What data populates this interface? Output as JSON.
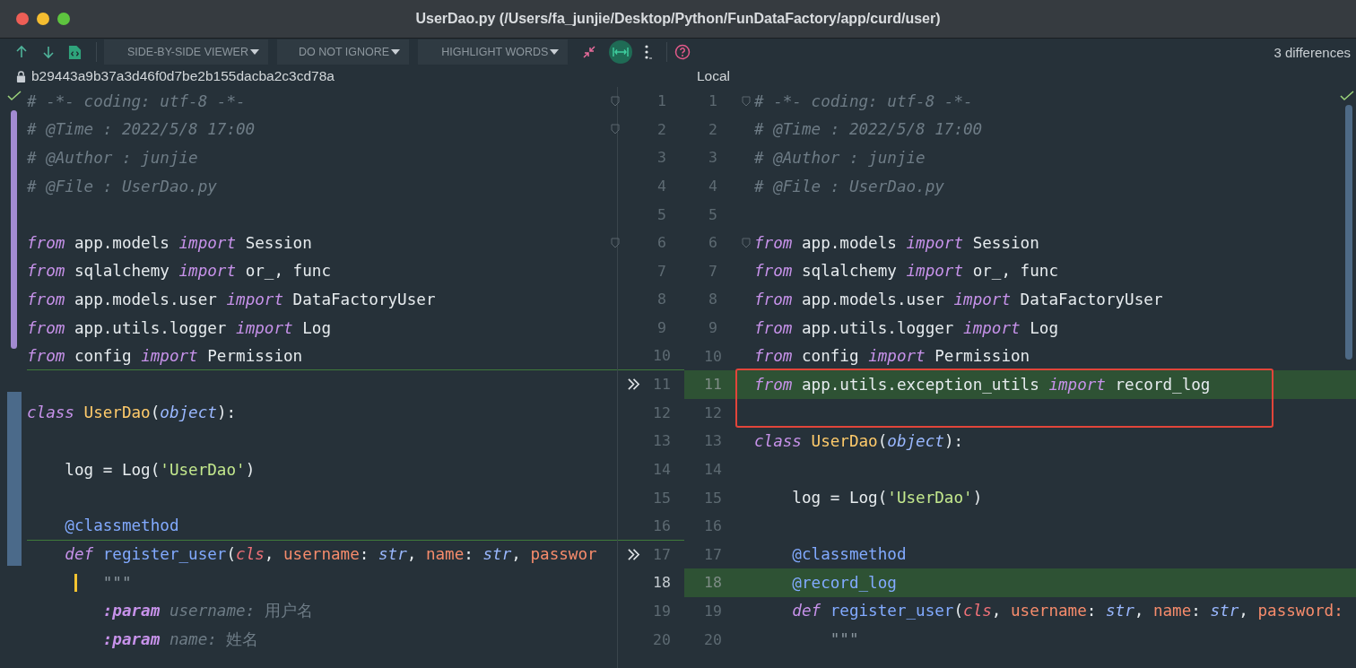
{
  "window": {
    "title": "UserDao.py (/Users/fa_junjie/Desktop/Python/FunDataFactory/app/curd/user)"
  },
  "toolbar": {
    "dropdowns": [
      "SIDE-BY-SIDE VIEWER",
      "DO NOT IGNORE",
      "HIGHLIGHT WORDS"
    ],
    "sync_scroll_on": true,
    "differences": "3 differences"
  },
  "left": {
    "revision": "b29443a9b37a3d46f0d7be2b155dacba2c3cd78a",
    "lines": [
      {
        "no": "1",
        "fold": true,
        "tokens": [
          {
            "kind": "comment",
            "t": "# -*- coding: utf-8 -*-"
          }
        ]
      },
      {
        "no": "2",
        "fold": true,
        "tokens": [
          {
            "kind": "comment",
            "t": "# @Time : 2022/5/8 17:00"
          }
        ]
      },
      {
        "no": "3",
        "tokens": [
          {
            "kind": "comment",
            "t": "# @Author : junjie"
          }
        ]
      },
      {
        "no": "4",
        "tokens": [
          {
            "kind": "comment",
            "t": "# @File : UserDao.py"
          }
        ]
      },
      {
        "no": "5"
      },
      {
        "no": "6",
        "fold": true,
        "tokens": [
          {
            "kind": "keyword",
            "t": "from"
          },
          {
            "kind": "plain",
            "t": " app.models "
          },
          {
            "kind": "keyword",
            "t": "import"
          },
          {
            "kind": "plain",
            "t": " Session"
          }
        ]
      },
      {
        "no": "7",
        "tokens": [
          {
            "kind": "keyword",
            "t": "from"
          },
          {
            "kind": "plain",
            "t": " sqlalchemy "
          },
          {
            "kind": "keyword",
            "t": "import"
          },
          {
            "kind": "plain",
            "t": " or_, func"
          }
        ]
      },
      {
        "no": "8",
        "tokens": [
          {
            "kind": "keyword",
            "t": "from"
          },
          {
            "kind": "plain",
            "t": " app.models.user "
          },
          {
            "kind": "keyword",
            "t": "import"
          },
          {
            "kind": "plain",
            "t": " DataFactoryUser"
          }
        ]
      },
      {
        "no": "9",
        "tokens": [
          {
            "kind": "keyword",
            "t": "from"
          },
          {
            "kind": "plain",
            "t": " app.utils.logger "
          },
          {
            "kind": "keyword",
            "t": "import"
          },
          {
            "kind": "plain",
            "t": " Log"
          }
        ]
      },
      {
        "no": "10",
        "inserted_below": true,
        "tokens": [
          {
            "kind": "keyword",
            "t": "from"
          },
          {
            "kind": "plain",
            "t": " config "
          },
          {
            "kind": "keyword",
            "t": "import"
          },
          {
            "kind": "plain",
            "t": " Permission"
          }
        ]
      },
      {
        "no": "11",
        "merge_arrow": true
      },
      {
        "no": "12",
        "tokens": [
          {
            "kind": "keyword",
            "t": "class"
          },
          {
            "kind": "classname",
            "t": " UserDao"
          },
          {
            "kind": "plain",
            "t": "("
          },
          {
            "kind": "type",
            "t": "object"
          },
          {
            "kind": "plain",
            "t": "):"
          }
        ]
      },
      {
        "no": "13"
      },
      {
        "no": "14",
        "tokens": [
          {
            "kind": "plain",
            "t": "    log = Log("
          },
          {
            "kind": "string",
            "t": "'UserDao'"
          },
          {
            "kind": "plain",
            "t": ")"
          }
        ]
      },
      {
        "no": "15"
      },
      {
        "no": "16",
        "inserted_below": true,
        "tokens": [
          {
            "kind": "decorator",
            "t": "    @classmethod"
          }
        ]
      },
      {
        "no": "17",
        "merge_arrow": true,
        "tokens": [
          {
            "kind": "keyword",
            "t": "    def"
          },
          {
            "kind": "function",
            "t": " register_user"
          },
          {
            "kind": "plain",
            "t": "("
          },
          {
            "kind": "self",
            "t": "cls"
          },
          {
            "kind": "plain",
            "t": ", "
          },
          {
            "kind": "param",
            "t": "username"
          },
          {
            "kind": "plain",
            "t": ": "
          },
          {
            "kind": "type",
            "t": "str"
          },
          {
            "kind": "plain",
            "t": ", "
          },
          {
            "kind": "param",
            "t": "name"
          },
          {
            "kind": "plain",
            "t": ": "
          },
          {
            "kind": "type",
            "t": "str"
          },
          {
            "kind": "plain",
            "t": ", "
          },
          {
            "kind": "param",
            "t": "passwor"
          }
        ]
      },
      {
        "no": "18",
        "current": true,
        "tokens": [
          {
            "kind": "quote",
            "t": "        \"\"\""
          }
        ]
      },
      {
        "no": "19",
        "tokens": [
          {
            "kind": "doctag",
            "t": "        :param"
          },
          {
            "kind": "docname",
            "t": " username:"
          },
          {
            "kind": "cjk",
            "t": " 用户名"
          }
        ]
      },
      {
        "no": "20",
        "tokens": [
          {
            "kind": "doctag",
            "t": "        :param"
          },
          {
            "kind": "docname",
            "t": " name:"
          },
          {
            "kind": "cjk",
            "t": " 姓名"
          }
        ]
      }
    ]
  },
  "right": {
    "label": "Local",
    "lines": [
      {
        "no": "1",
        "fold": true,
        "tokens": [
          {
            "kind": "comment",
            "t": "# -*- coding: utf-8 -*-"
          }
        ]
      },
      {
        "no": "2",
        "tokens": [
          {
            "kind": "comment",
            "t": "# @Time : 2022/5/8 17:00"
          }
        ]
      },
      {
        "no": "3",
        "tokens": [
          {
            "kind": "comment",
            "t": "# @Author : junjie"
          }
        ]
      },
      {
        "no": "4",
        "tokens": [
          {
            "kind": "comment",
            "t": "# @File : UserDao.py"
          }
        ]
      },
      {
        "no": "5"
      },
      {
        "no": "6",
        "fold": true,
        "tokens": [
          {
            "kind": "keyword",
            "t": "from"
          },
          {
            "kind": "plain",
            "t": " app.models "
          },
          {
            "kind": "keyword",
            "t": "import"
          },
          {
            "kind": "plain",
            "t": " Session"
          }
        ]
      },
      {
        "no": "7",
        "tokens": [
          {
            "kind": "keyword",
            "t": "from"
          },
          {
            "kind": "plain",
            "t": " sqlalchemy "
          },
          {
            "kind": "keyword",
            "t": "import"
          },
          {
            "kind": "plain",
            "t": " or_, func"
          }
        ]
      },
      {
        "no": "8",
        "tokens": [
          {
            "kind": "keyword",
            "t": "from"
          },
          {
            "kind": "plain",
            "t": " app.models.user "
          },
          {
            "kind": "keyword",
            "t": "import"
          },
          {
            "kind": "plain",
            "t": " DataFactoryUser"
          }
        ]
      },
      {
        "no": "9",
        "tokens": [
          {
            "kind": "keyword",
            "t": "from"
          },
          {
            "kind": "plain",
            "t": " app.utils.logger "
          },
          {
            "kind": "keyword",
            "t": "import"
          },
          {
            "kind": "plain",
            "t": " Log"
          }
        ]
      },
      {
        "no": "10",
        "tokens": [
          {
            "kind": "keyword",
            "t": "from"
          },
          {
            "kind": "plain",
            "t": " config "
          },
          {
            "kind": "keyword",
            "t": "import"
          },
          {
            "kind": "plain",
            "t": " Permission"
          }
        ]
      },
      {
        "no": "11",
        "changed": true,
        "tokens": [
          {
            "kind": "keyword",
            "t": "from"
          },
          {
            "kind": "plain",
            "t": " app.utils.exception_utils "
          },
          {
            "kind": "keyword",
            "t": "import"
          },
          {
            "kind": "plain",
            "t": " record_log"
          }
        ]
      },
      {
        "no": "12"
      },
      {
        "no": "13",
        "tokens": [
          {
            "kind": "keyword",
            "t": "class"
          },
          {
            "kind": "classname",
            "t": " UserDao"
          },
          {
            "kind": "plain",
            "t": "("
          },
          {
            "kind": "type",
            "t": "object"
          },
          {
            "kind": "plain",
            "t": "):"
          }
        ]
      },
      {
        "no": "14"
      },
      {
        "no": "15",
        "tokens": [
          {
            "kind": "plain",
            "t": "    log = Log("
          },
          {
            "kind": "string",
            "t": "'UserDao'"
          },
          {
            "kind": "plain",
            "t": ")"
          }
        ]
      },
      {
        "no": "16"
      },
      {
        "no": "17",
        "tokens": [
          {
            "kind": "decorator",
            "t": "    @classmethod"
          }
        ]
      },
      {
        "no": "18",
        "changed": true,
        "tokens": [
          {
            "kind": "decorator",
            "t": "    @record_log"
          }
        ]
      },
      {
        "no": "19",
        "tokens": [
          {
            "kind": "keyword",
            "t": "    def"
          },
          {
            "kind": "function",
            "t": " register_user"
          },
          {
            "kind": "plain",
            "t": "("
          },
          {
            "kind": "self",
            "t": "cls"
          },
          {
            "kind": "plain",
            "t": ", "
          },
          {
            "kind": "param",
            "t": "username"
          },
          {
            "kind": "plain",
            "t": ": "
          },
          {
            "kind": "type",
            "t": "str"
          },
          {
            "kind": "plain",
            "t": ", "
          },
          {
            "kind": "param",
            "t": "name"
          },
          {
            "kind": "plain",
            "t": ": "
          },
          {
            "kind": "type",
            "t": "str"
          },
          {
            "kind": "plain",
            "t": ", "
          },
          {
            "kind": "param",
            "t": "password:"
          }
        ]
      },
      {
        "no": "20",
        "tokens": [
          {
            "kind": "quote",
            "t": "        \"\"\""
          }
        ]
      }
    ]
  }
}
